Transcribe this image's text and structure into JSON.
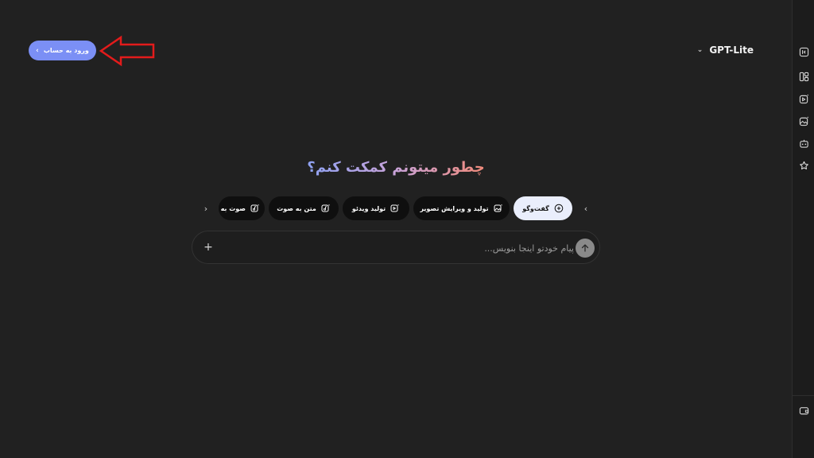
{
  "header": {
    "login_label": "ورود به حساب",
    "login_chevron": "›",
    "model_name": "GPT-Lite",
    "model_chevron": "⌄"
  },
  "main": {
    "heading": "چطور میتونم کمکت کنم؟"
  },
  "chips": [
    {
      "label": "گفت‌وگو",
      "icon": "chat-plus-icon",
      "active": true
    },
    {
      "label": "تولید و ویرایش تصویر",
      "icon": "image-edit-icon",
      "active": false
    },
    {
      "label": "تولید ویدئو",
      "icon": "video-sparkle-icon",
      "active": false
    },
    {
      "label": "متن به صوت",
      "icon": "music-sparkle-icon",
      "active": false
    },
    {
      "label": "صوت به",
      "icon": "music-sparkle-icon",
      "active": false
    }
  ],
  "chip_nav": {
    "prev": "‹",
    "next": "›"
  },
  "composer": {
    "placeholder": "پیام خودتو اینجا بنویس...",
    "plus": "+"
  },
  "rail": {
    "items": [
      "sidebar-toggle-icon",
      "layout-icon",
      "video-sparkle-icon",
      "image-sparkle-icon",
      "robot-icon",
      "sparkle-star-icon",
      "wallet-icon"
    ]
  },
  "colors": {
    "background": "#212121",
    "accent": "#7b8ff5",
    "annotation_arrow": "#e31b1b"
  }
}
